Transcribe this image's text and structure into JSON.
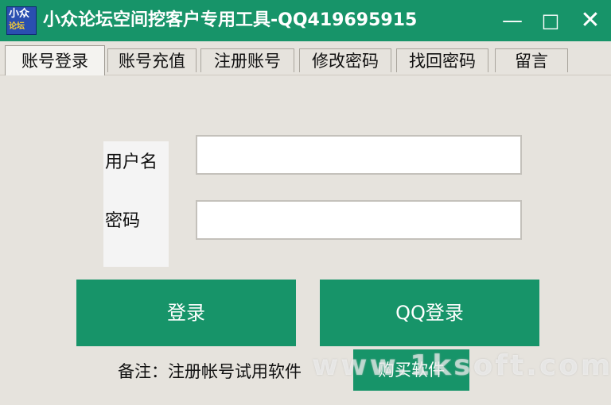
{
  "window": {
    "title": "小众论坛空间挖客户专用工具-QQ419695915",
    "icon_text_top": "小众",
    "icon_text_bottom": "论坛",
    "controls": {
      "minimize": "—",
      "maximize": "□",
      "close": "✕"
    }
  },
  "tabs": [
    {
      "label": "账号登录",
      "active": true
    },
    {
      "label": "账号充值",
      "active": false
    },
    {
      "label": "注册账号",
      "active": false
    },
    {
      "label": "修改密码",
      "active": false
    },
    {
      "label": "找回密码",
      "active": false
    },
    {
      "label": "留言",
      "active": false
    }
  ],
  "login": {
    "username_label": "用户名",
    "username_value": "",
    "password_label": "密码",
    "password_value": "",
    "login_button": "登录",
    "qq_login_button": "QQ登录"
  },
  "footer": {
    "note": "备注：注册帐号试用软件",
    "buy_button": "购买软件",
    "watermark": "www.1ksoft.com"
  },
  "colors": {
    "accent": "#179469",
    "background": "#e6e3dd"
  }
}
